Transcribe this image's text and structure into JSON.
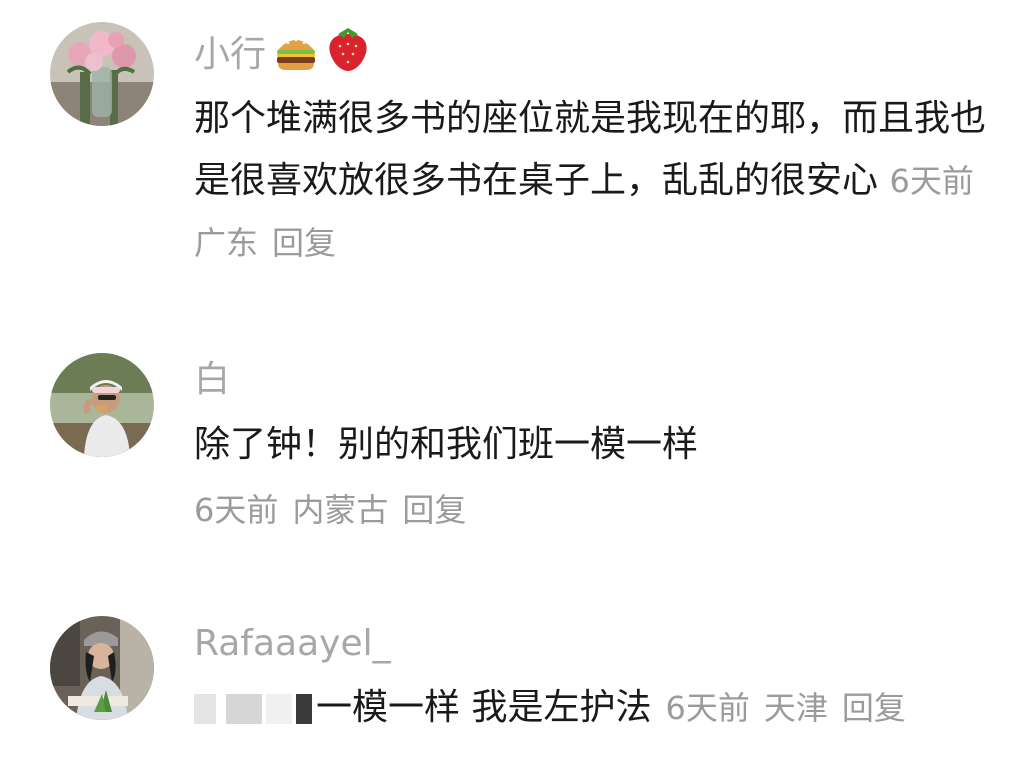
{
  "comments": [
    {
      "username": "小行",
      "emojis": [
        "burger-emoji",
        "strawberry-emoji"
      ],
      "text": "那个堆满很多书的座位就是我现在的耶，而且我也是很喜欢放很多书在桌子上，乱乱的很安心",
      "time": "6天前",
      "location": "广东",
      "reply_label": "回复"
    },
    {
      "username": "白",
      "text": "除了钟！别的和我们班一模一样",
      "time": "6天前",
      "location": "内蒙古",
      "reply_label": "回复"
    },
    {
      "username": "Rafaaayel_",
      "text": "一模一样 我是左护法",
      "time": "6天前",
      "location": "天津",
      "reply_label": "回复"
    }
  ],
  "colors": {
    "username": "#a7a7a7",
    "text": "#1a1a1a",
    "meta": "#9b9b9b",
    "background": "#ffffff"
  }
}
